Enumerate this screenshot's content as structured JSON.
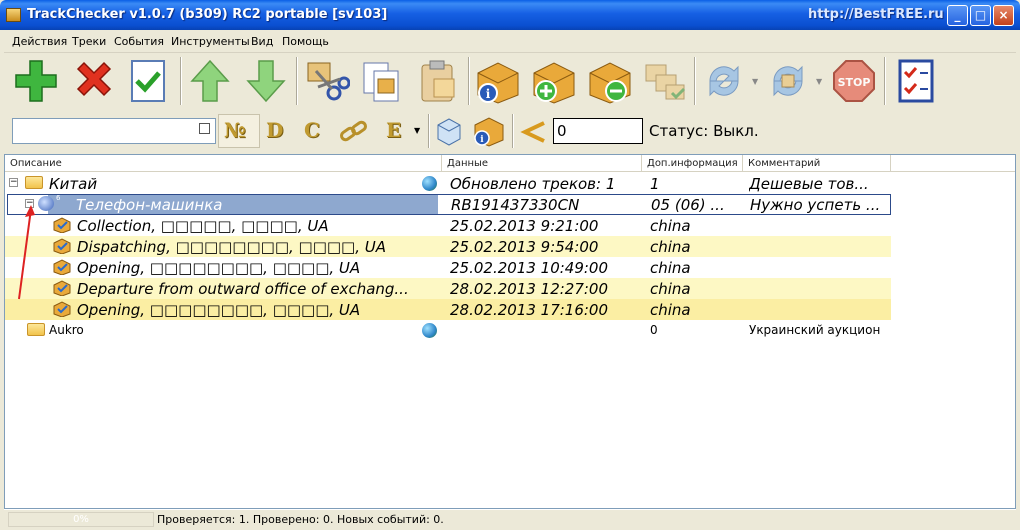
{
  "window": {
    "title": "TrackChecker v1.0.7 (b309) RC2 portable [sv103]",
    "site": "http://BestFREE.ru",
    "minimize": "_",
    "maximize": "□",
    "close": "×"
  },
  "menu": [
    "Действия",
    "Треки",
    "События",
    "Инструменты",
    "Вид",
    "Помощь"
  ],
  "toolbar2": {
    "search_value": "",
    "letters": [
      "№",
      "D",
      "C",
      "E"
    ],
    "number_value": "0",
    "status": "Статус: Выкл."
  },
  "columns": [
    "Описание",
    "Данные",
    "Доп.информация",
    "Комментарий"
  ],
  "rows": [
    {
      "desc": "Китай",
      "data": "Обновлено треков: 1",
      "info": "1",
      "comment": "Дешевые тов..."
    },
    {
      "desc": "Телефон-машинка",
      "badge": "6",
      "data": "RB191437330CN",
      "info": "05 (06) ...",
      "comment": "Нужно успеть ..."
    },
    {
      "desc": "Collection, □□□□□, □□□□, UA",
      "data": "25.02.2013 9:21:00",
      "info": "china",
      "comment": ""
    },
    {
      "desc": "Dispatching, □□□□□□□□, □□□□, UA",
      "data": "25.02.2013 9:54:00",
      "info": "china",
      "comment": ""
    },
    {
      "desc": "Opening, □□□□□□□□, □□□□, UA",
      "data": "25.02.2013 10:49:00",
      "info": "china",
      "comment": ""
    },
    {
      "desc": "Departure from outward office of exchang...",
      "data": "28.02.2013 12:27:00",
      "info": "china",
      "comment": ""
    },
    {
      "desc": "Opening, □□□□□□□□, □□□□, UA",
      "data": "28.02.2013 17:16:00",
      "info": "china",
      "comment": ""
    },
    {
      "desc": "Aukro",
      "data": "",
      "info": "0",
      "comment": "Украинский аукцион"
    }
  ],
  "statusbar": {
    "progress": "0%",
    "message": "Проверяется: 1. Проверено: 0. Новых событий: 0."
  }
}
